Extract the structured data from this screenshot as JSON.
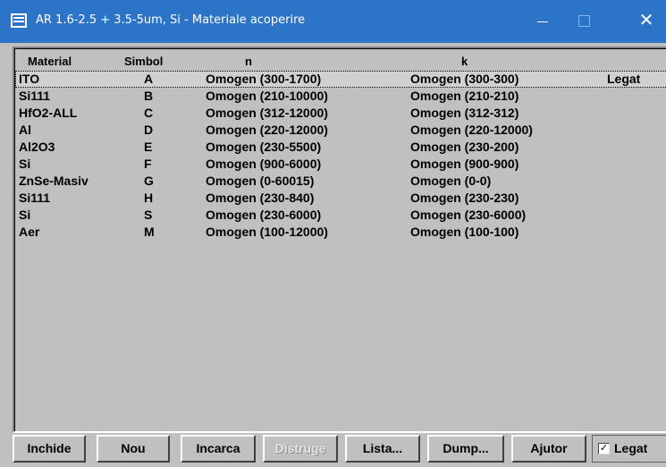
{
  "window": {
    "title": "AR 1.6-2.5 + 3.5-5um, Si - Materiale acoperire",
    "close_glyph": "✕"
  },
  "table": {
    "headers": {
      "material": "Material",
      "symbol": "Simbol",
      "n": "n",
      "k": "k"
    },
    "rows": [
      {
        "material": "ITO",
        "symbol": "A",
        "n": "Omogen (300-1700)",
        "k": "Omogen (300-300)",
        "legat": "Legat"
      },
      {
        "material": "Si111",
        "symbol": "B",
        "n": "Omogen (210-10000)",
        "k": "Omogen (210-210)",
        "legat": ""
      },
      {
        "material": "HfO2-ALL",
        "symbol": "C",
        "n": "Omogen (312-12000)",
        "k": "Omogen (312-312)",
        "legat": ""
      },
      {
        "material": "Al",
        "symbol": "D",
        "n": "Omogen (220-12000)",
        "k": "Omogen (220-12000)",
        "legat": ""
      },
      {
        "material": "Al2O3",
        "symbol": "E",
        "n": "Omogen (230-5500)",
        "k": "Omogen (230-200)",
        "legat": ""
      },
      {
        "material": "Si",
        "symbol": "F",
        "n": "Omogen (900-6000)",
        "k": "Omogen (900-900)",
        "legat": ""
      },
      {
        "material": "ZnSe-Masiv",
        "symbol": "G",
        "n": "Omogen (0-60015)",
        "k": "Omogen (0-0)",
        "legat": ""
      },
      {
        "material": "Si111",
        "symbol": "H",
        "n": "Omogen (230-840)",
        "k": "Omogen (230-230)",
        "legat": ""
      },
      {
        "material": "Si",
        "symbol": "S",
        "n": "Omogen (230-6000)",
        "k": "Omogen (230-6000)",
        "legat": ""
      },
      {
        "material": "Aer",
        "symbol": "M",
        "n": "Omogen (100-12000)",
        "k": "Omogen (100-100)",
        "legat": ""
      }
    ]
  },
  "buttons": {
    "inchide": "Inchide",
    "nou": "Nou",
    "incarca": "Incarca",
    "distruge": "Distruge",
    "lista": "Lista...",
    "dump": "Dump...",
    "ajutor": "Ajutor"
  },
  "legat_checkbox": {
    "label": "Legat",
    "checked_glyph": "✓"
  },
  "colors": {
    "titlebar": "#2b74c7",
    "face": "#c0c0c0"
  }
}
